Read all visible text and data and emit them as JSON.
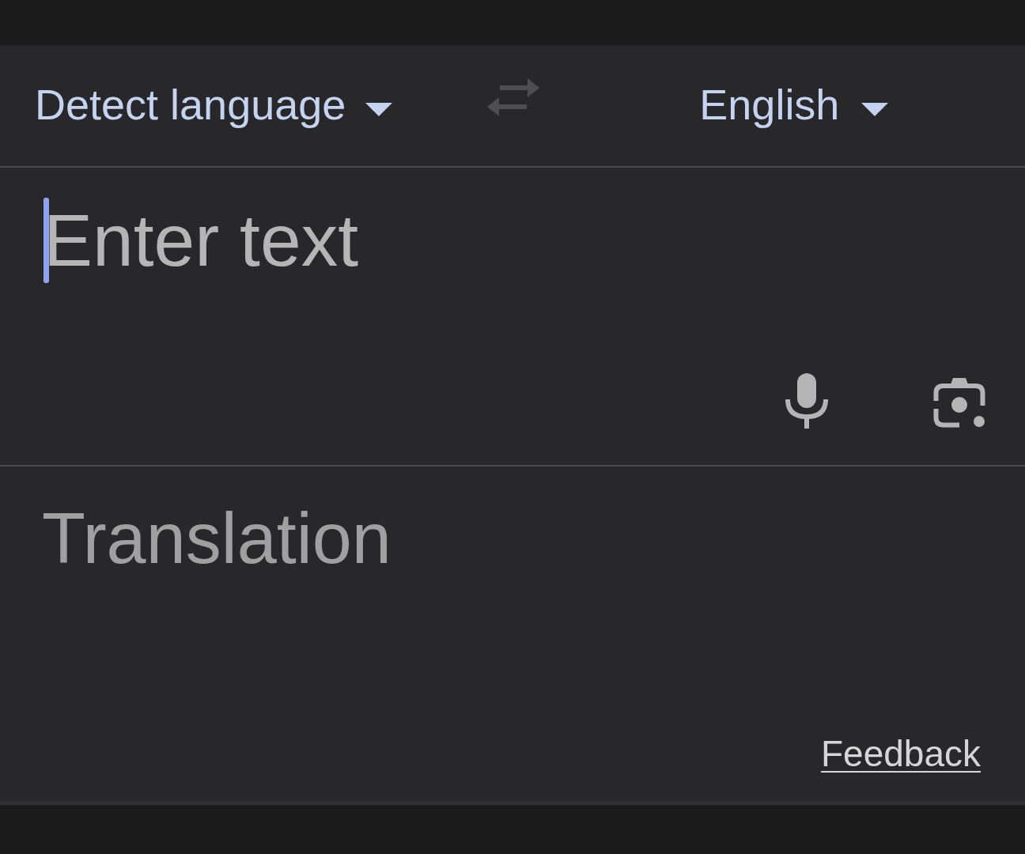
{
  "source_language": {
    "label": "Detect language"
  },
  "swap_button": {
    "disabled": true
  },
  "target_language": {
    "label": "English"
  },
  "input": {
    "placeholder": "Enter text",
    "focused": true
  },
  "output": {
    "placeholder": "Translation"
  },
  "feedback_link": {
    "label": "Feedback"
  }
}
